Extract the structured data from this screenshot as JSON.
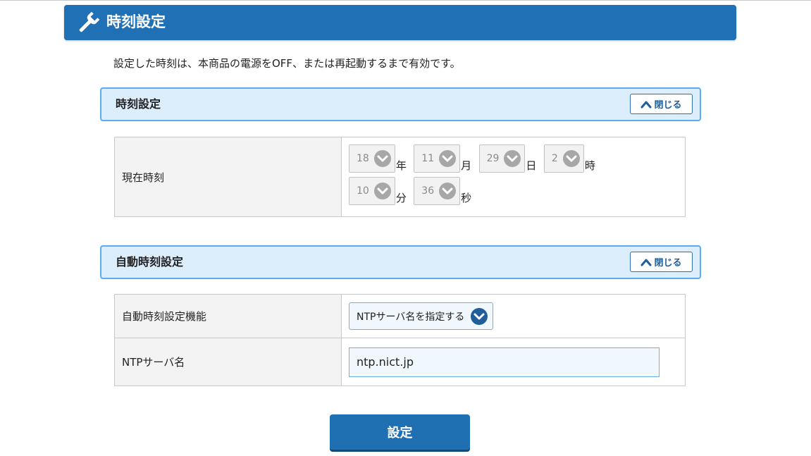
{
  "page": {
    "title": "時刻設定",
    "description": "設定した時刻は、本商品の電源をOFF、または再起動するまで有効です。"
  },
  "time_section": {
    "title": "時刻設定",
    "close_label": "閉じる",
    "current_time_label": "現在時刻",
    "fields": [
      {
        "value": "18",
        "suffix": "年"
      },
      {
        "value": "11",
        "suffix": "月"
      },
      {
        "value": "29",
        "suffix": "日"
      },
      {
        "value": "2",
        "suffix": "時"
      },
      {
        "value": "10",
        "suffix": "分"
      },
      {
        "value": "36",
        "suffix": "秒"
      }
    ]
  },
  "auto_section": {
    "title": "自動時刻設定",
    "close_label": "閉じる",
    "function_label": "自動時刻設定機能",
    "function_value": "NTPサーバ名を指定する",
    "ntp_label": "NTPサーバ名",
    "ntp_value": "ntp.nict.jp"
  },
  "submit_label": "設定",
  "colors": {
    "header_blue": "#1f70b5",
    "section_bg": "#dcedfb",
    "section_border": "#5aaef0",
    "chevron_blue": "#1f5e99"
  }
}
